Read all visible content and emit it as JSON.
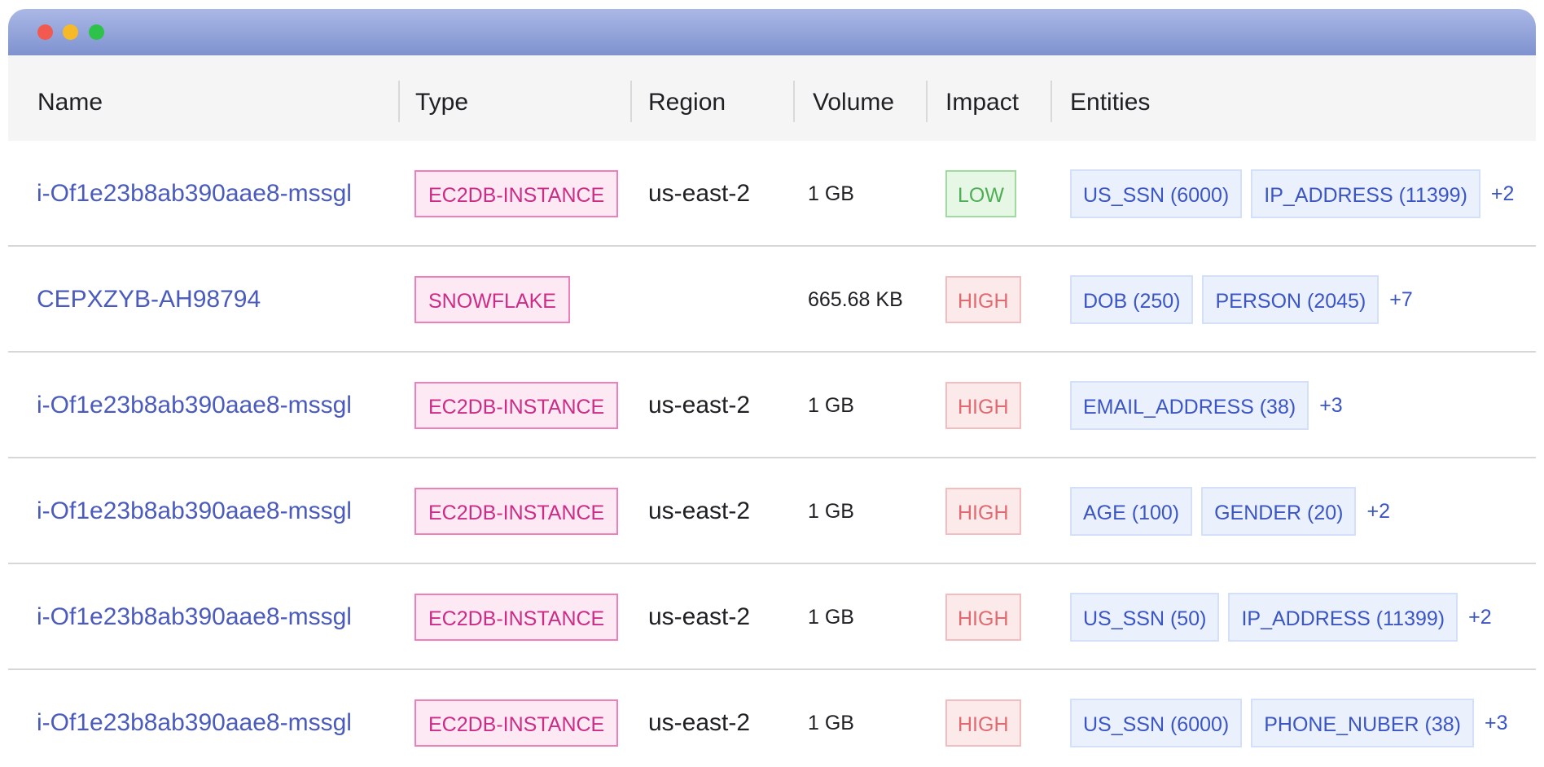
{
  "window": {
    "controls": [
      "close",
      "minimize",
      "maximize"
    ]
  },
  "table": {
    "columns": [
      "Name",
      "Type",
      "Region",
      "Volume",
      "Impact",
      "Entities"
    ],
    "rows": [
      {
        "name": "i-Of1e23b8ab390aae8-mssgl",
        "type": "EC2DB-INSTANCE",
        "region": "us-east-2",
        "volume": "1 GB",
        "impact": "LOW",
        "impact_level": "low",
        "entities": [
          "US_SSN (6000)",
          "IP_ADDRESS (11399)"
        ],
        "more": "+2"
      },
      {
        "name": "CEPXZYB-AH98794",
        "type": "SNOWFLAKE",
        "region": "",
        "volume": "665.68 KB",
        "impact": "HIGH",
        "impact_level": "high",
        "entities": [
          "DOB (250)",
          "PERSON (2045)"
        ],
        "more": "+7"
      },
      {
        "name": "i-Of1e23b8ab390aae8-mssgl",
        "type": "EC2DB-INSTANCE",
        "region": "us-east-2",
        "volume": "1 GB",
        "impact": "HIGH",
        "impact_level": "high",
        "entities": [
          "EMAIL_ADDRESS (38)"
        ],
        "more": "+3"
      },
      {
        "name": "i-Of1e23b8ab390aae8-mssgl",
        "type": "EC2DB-INSTANCE",
        "region": "us-east-2",
        "volume": "1 GB",
        "impact": "HIGH",
        "impact_level": "high",
        "entities": [
          "AGE (100)",
          "GENDER (20)"
        ],
        "more": "+2"
      },
      {
        "name": "i-Of1e23b8ab390aae8-mssgl",
        "type": "EC2DB-INSTANCE",
        "region": "us-east-2",
        "volume": "1 GB",
        "impact": "HIGH",
        "impact_level": "high",
        "entities": [
          "US_SSN (50)",
          "IP_ADDRESS (11399)"
        ],
        "more": "+2"
      },
      {
        "name": "i-Of1e23b8ab390aae8-mssgl",
        "type": "EC2DB-INSTANCE",
        "region": "us-east-2",
        "volume": "1 GB",
        "impact": "HIGH",
        "impact_level": "high",
        "entities": [
          "US_SSN (6000)",
          "PHONE_NUBER (38)"
        ],
        "more": "+3"
      }
    ]
  }
}
